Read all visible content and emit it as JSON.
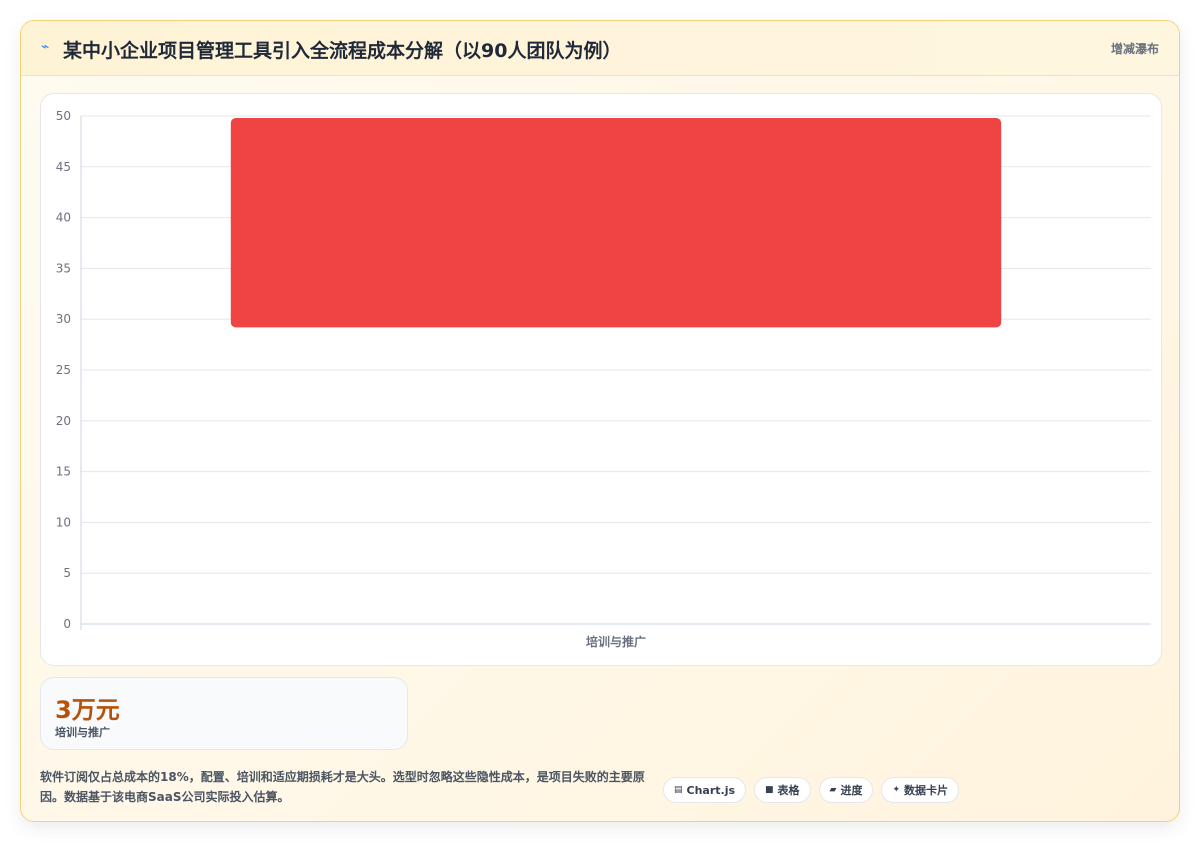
{
  "header": {
    "title": "某中小企业项目管理工具引入全流程成本分解（以90人团队为例）",
    "title_icon": "chart-icon",
    "action_label": "增减瀑布"
  },
  "chart_data": {
    "type": "bar",
    "subtype": "waterfall",
    "categories": [
      "培训与推广"
    ],
    "ranges": [
      [
        29.2,
        49.8
      ]
    ],
    "ylim": [
      0,
      50
    ],
    "yticks": [
      0,
      5,
      10,
      15,
      20,
      25,
      30,
      35,
      40,
      45,
      50
    ],
    "grid": true,
    "bar_color": "#ef4444"
  },
  "stat": {
    "value": "3万元",
    "label": "培训与推广"
  },
  "note": "软件订阅仅占总成本的18%，配置、培训和适应期损耗才是大头。选型时忽略这些隐性成本，是项目失败的主要原因。数据基于该电商SaaS公司实际投入估算。",
  "chips": [
    {
      "icon": "chart-icon",
      "glyph": "▤",
      "label": "Chart.js"
    },
    {
      "icon": "table-icon",
      "glyph": "■",
      "label": "表格"
    },
    {
      "icon": "progress-icon",
      "glyph": "▰",
      "label": "进度"
    },
    {
      "icon": "card-icon",
      "glyph": "✦",
      "label": "数据卡片"
    }
  ]
}
